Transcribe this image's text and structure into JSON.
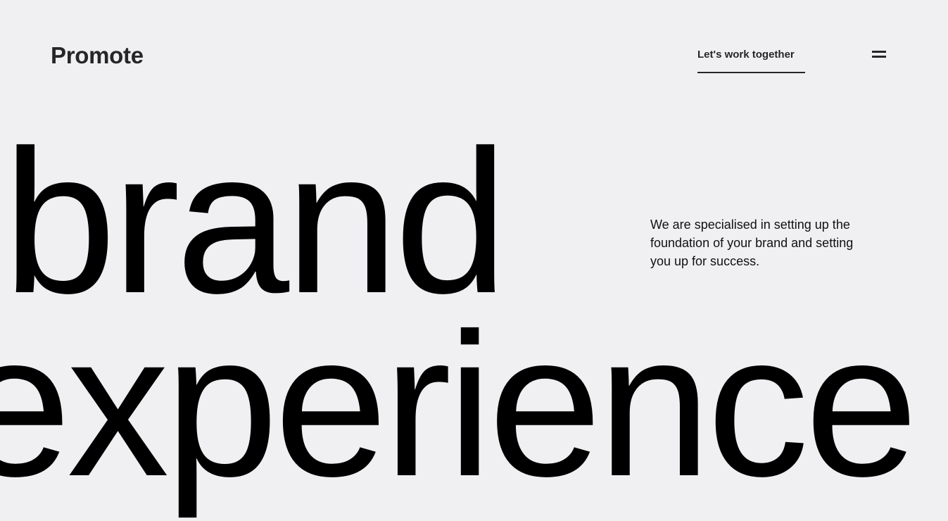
{
  "header": {
    "logo_text": "Promote",
    "cta_label": "Let's work together",
    "menu_icon": "hamburger-menu-icon"
  },
  "hero": {
    "words": [
      "brand",
      "experience"
    ],
    "tagline": "We are specialised in setting up the foundation of your brand and setting you up for success."
  },
  "colors": {
    "background": "#f0f0f3",
    "text": "#262629",
    "hero_text": "#000000"
  }
}
